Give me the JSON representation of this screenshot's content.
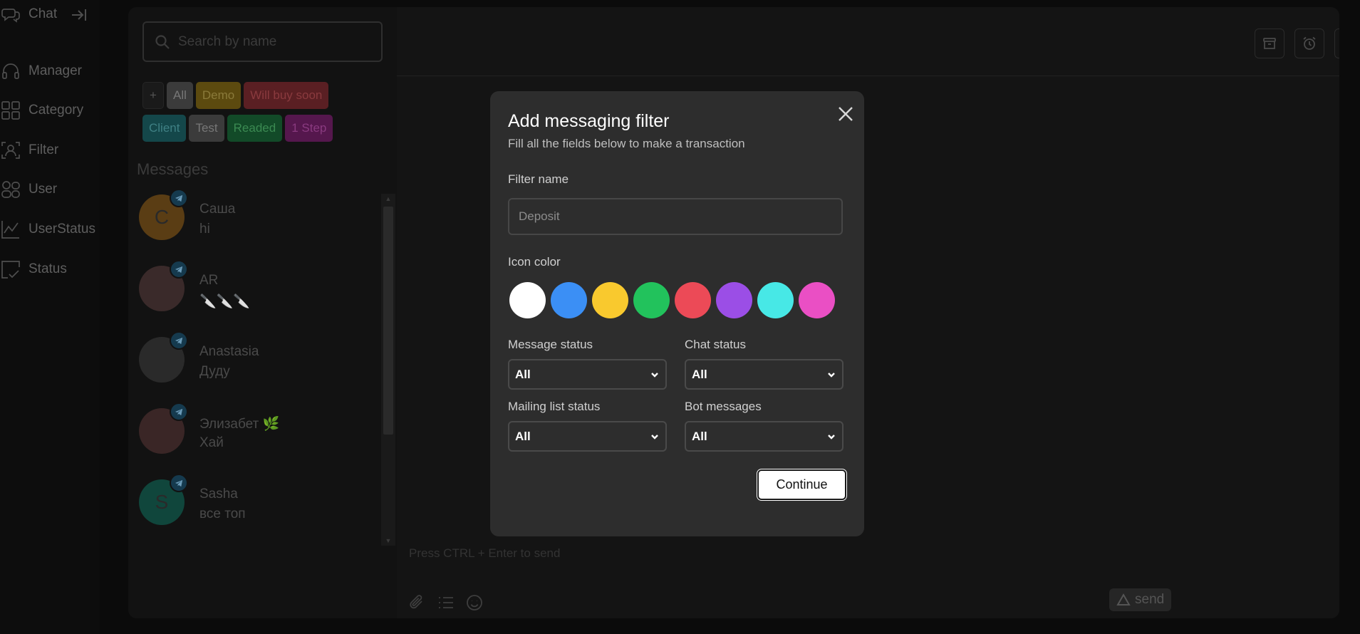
{
  "rail": {
    "items": [
      {
        "label": "Chat",
        "icon": "chat-icon"
      },
      {
        "label": "Manager",
        "icon": "headphones-icon"
      },
      {
        "label": "Category",
        "icon": "grid-icon"
      },
      {
        "label": "Filter",
        "icon": "user-filter-icon"
      },
      {
        "label": "User",
        "icon": "users-icon"
      },
      {
        "label": "UserStatus",
        "icon": "line-chart-icon"
      },
      {
        "label": "Status",
        "icon": "status-check-icon"
      }
    ]
  },
  "search": {
    "placeholder": "Search by name"
  },
  "tags": [
    {
      "label": "All",
      "bg": "#3b3b3b",
      "color": "#777777"
    },
    {
      "label": "Demo",
      "bg": "#5c4a0f",
      "color": "#8a7a3a"
    },
    {
      "label": "Will buy soon",
      "bg": "#5a1f23",
      "color": "#8a3a3e"
    },
    {
      "label": "Client",
      "bg": "#14474a",
      "color": "#3f8084"
    },
    {
      "label": "Test",
      "bg": "#3b3b3b",
      "color": "#777777"
    },
    {
      "label": "Readed",
      "bg": "#124a28",
      "color": "#3b8a52"
    },
    {
      "label": "1 Step",
      "bg": "#55174d",
      "color": "#8a3a80"
    }
  ],
  "messages_title": "Messages",
  "chats": [
    {
      "name": "Саша",
      "preview": "hi",
      "initial": "С",
      "avatar_color": "#5a3d14"
    },
    {
      "name": "AR",
      "preview": "🔪🔪🔪",
      "initial": "",
      "avatar_color": "#3a2a2a"
    },
    {
      "name": "Anastasia",
      "preview": "Дуду",
      "initial": "",
      "avatar_color": "#2a2a2a"
    },
    {
      "name": "Элизабет 🌿",
      "preview": "Хай",
      "initial": "",
      "avatar_color": "#3a2626"
    },
    {
      "name": "Sasha",
      "preview": "все топ",
      "initial": "S",
      "avatar_color": "#10463c"
    }
  ],
  "composer": {
    "placeholder": "Press CTRL + Enter to send",
    "send_label": "send"
  },
  "modal": {
    "title": "Add messaging filter",
    "subtitle": "Fill all the fields below to make a transaction",
    "filter_name_label": "Filter name",
    "filter_name_placeholder": "Deposit",
    "icon_color_label": "Icon color",
    "colors": [
      "#ffffff",
      "#3b8ff5",
      "#f9c92e",
      "#22c25c",
      "#ec4a57",
      "#9b4ee6",
      "#47e8e6",
      "#ea4fc4"
    ],
    "message_status_label": "Message status",
    "message_status_value": "All",
    "chat_status_label": "Chat status",
    "chat_status_value": "All",
    "mailing_status_label": "Mailing list status",
    "mailing_status_value": "All",
    "bot_messages_label": "Bot messages",
    "bot_messages_value": "All",
    "continue_label": "Continue"
  }
}
